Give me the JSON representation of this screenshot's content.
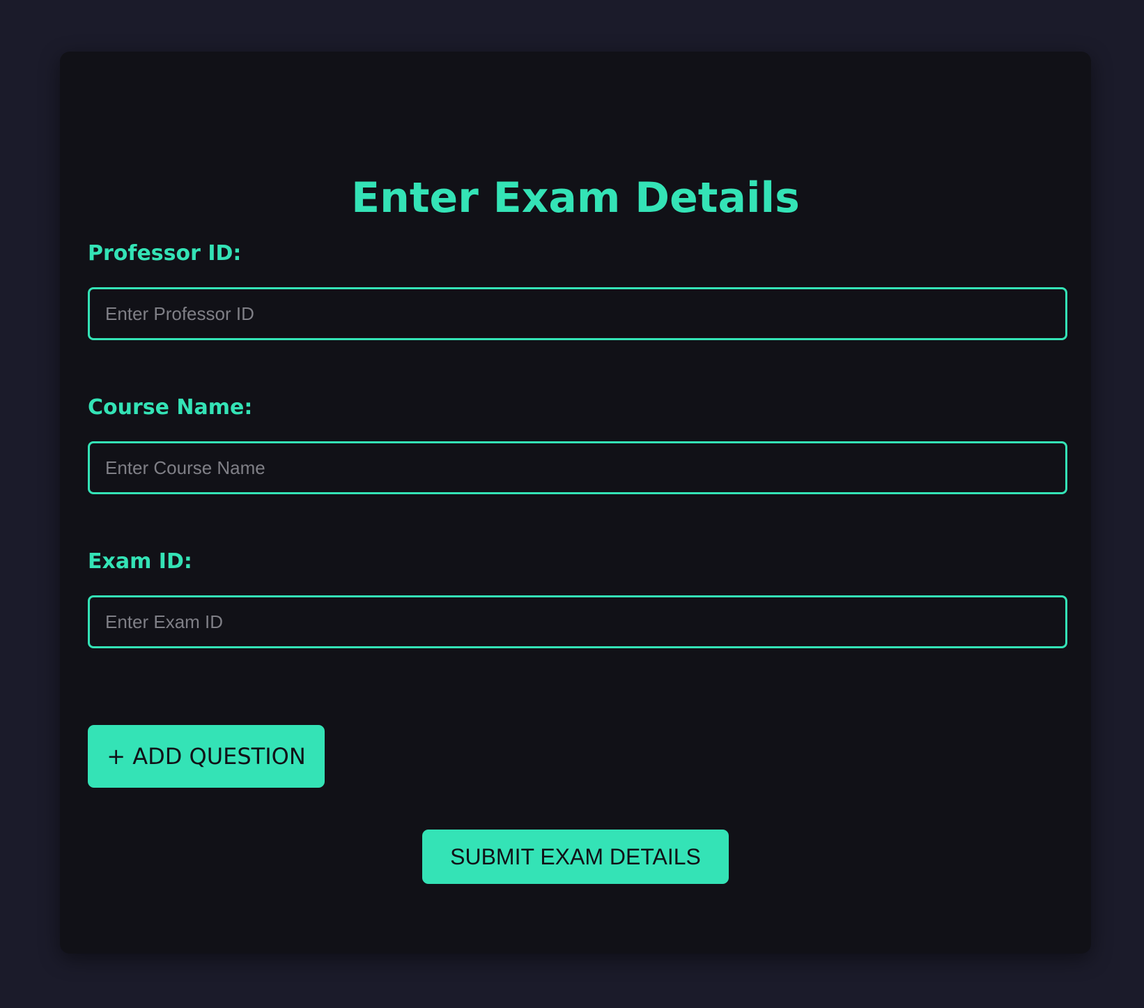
{
  "form": {
    "title": "Enter Exam Details",
    "fields": [
      {
        "label": "Professor ID:",
        "placeholder": "Enter Professor ID",
        "value": ""
      },
      {
        "label": "Course Name:",
        "placeholder": "Enter Course Name",
        "value": ""
      },
      {
        "label": "Exam ID:",
        "placeholder": "Enter Exam ID",
        "value": ""
      }
    ],
    "add_question_label": "+ ADD QUESTION",
    "submit_label": "SUBMIT EXAM DETAILS"
  },
  "colors": {
    "page_background": "#1b1b2a",
    "card_background": "#111117",
    "accent": "#34e3b6",
    "placeholder_text": "#7f7f86",
    "button_text": "#111117"
  }
}
